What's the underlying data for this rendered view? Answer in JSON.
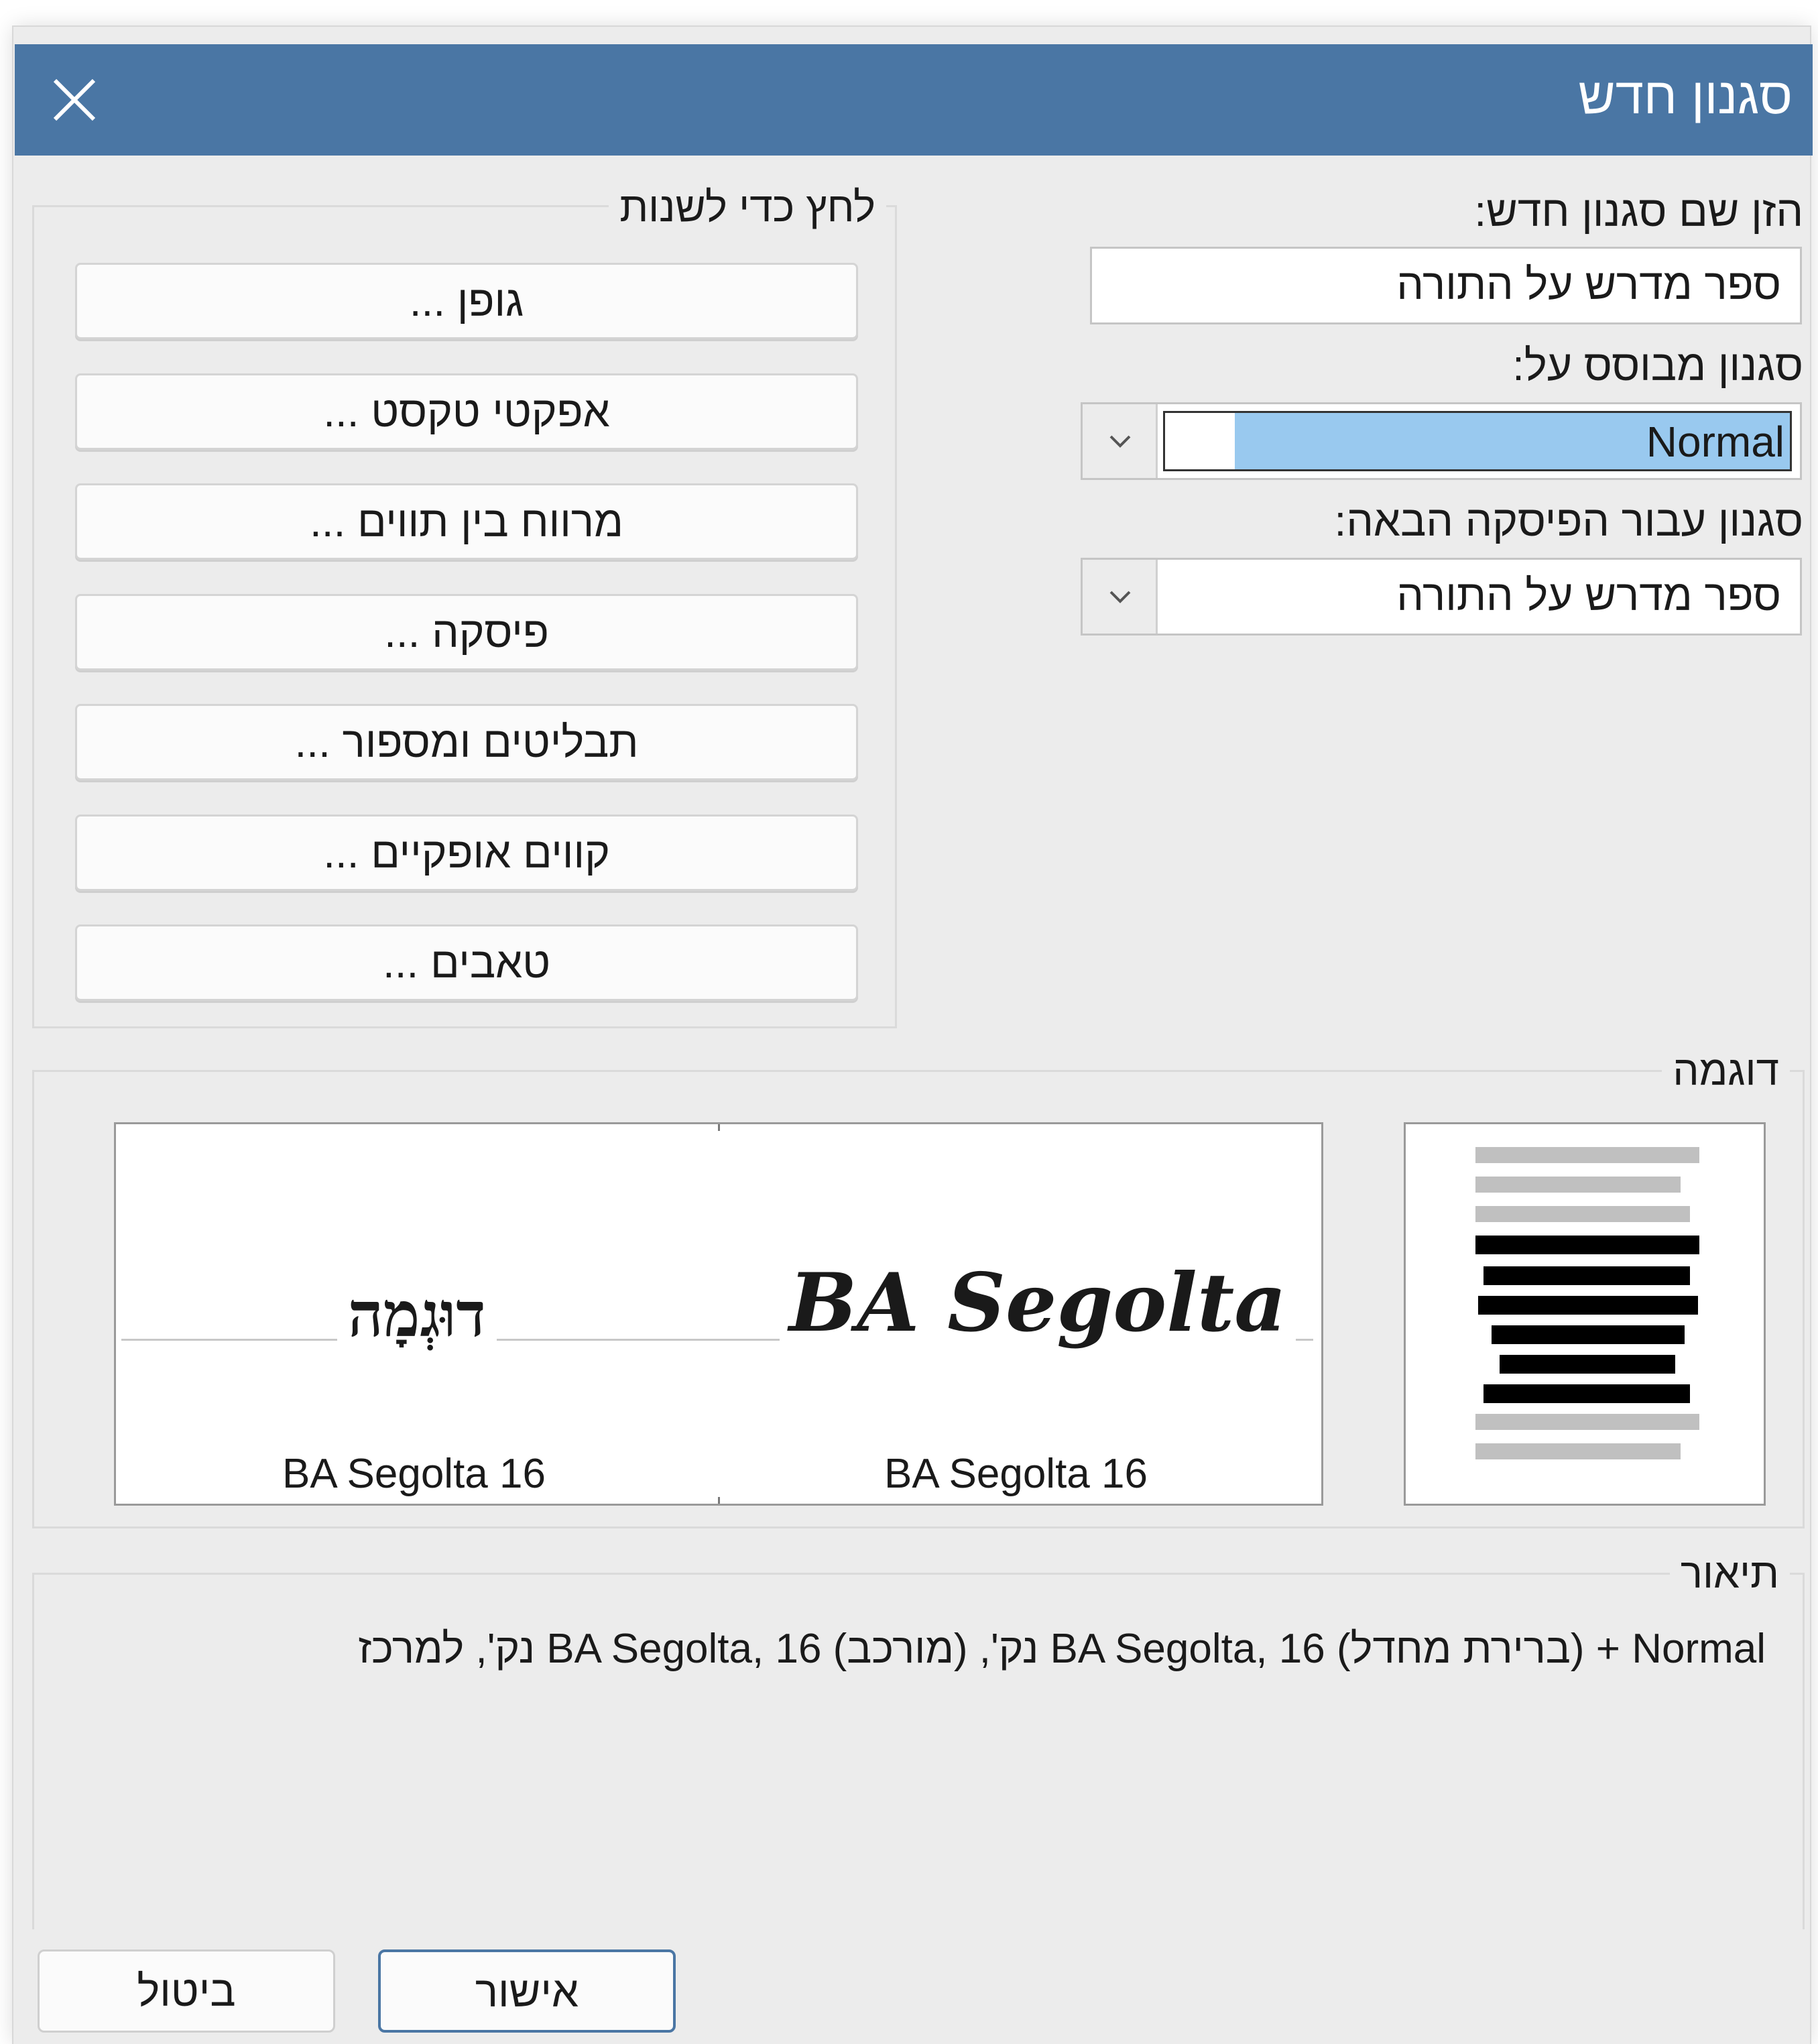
{
  "window": {
    "title": "סגנון חדש"
  },
  "form": {
    "name_label": "הזן שם סגנון חדש:",
    "name_value": "ספר מדרש על התורה",
    "based_on_label": "סגנון מבוסס על:",
    "based_on_value": "Normal",
    "next_style_label": "סגנון עבור הפיסקה הבאה:",
    "next_style_value": "ספר מדרש על התורה"
  },
  "modify_group": {
    "legend": "לחץ כדי לשנות",
    "buttons": [
      {
        "label": "גופן ..."
      },
      {
        "label": "אפקטי טקסט ..."
      },
      {
        "label": "מרווח בין תווים ..."
      },
      {
        "label": "פיסקה ..."
      },
      {
        "label": "תבליטים ומספור ..."
      },
      {
        "label": "קווים אופקיים ..."
      },
      {
        "label": "טאבים ..."
      }
    ]
  },
  "sample": {
    "legend": "דוגמה",
    "latin_sample_text": "BA Segolta",
    "latin_font_label": "BA Segolta 16",
    "hebrew_sample_text": "דוּגְמָה",
    "hebrew_font_label": "BA Segolta 16"
  },
  "description": {
    "legend": "תיאור",
    "text": "Normal + (ברירת מחדל) BA Segolta, 16 נק', (מורכב) BA Segolta, 16 נק', למרכז"
  },
  "footer": {
    "ok_label": "אישור",
    "cancel_label": "ביטול"
  },
  "colors": {
    "titlebar": "#4a76a4",
    "selection": "#99c9ef",
    "ok_border": "#4a76a4"
  }
}
